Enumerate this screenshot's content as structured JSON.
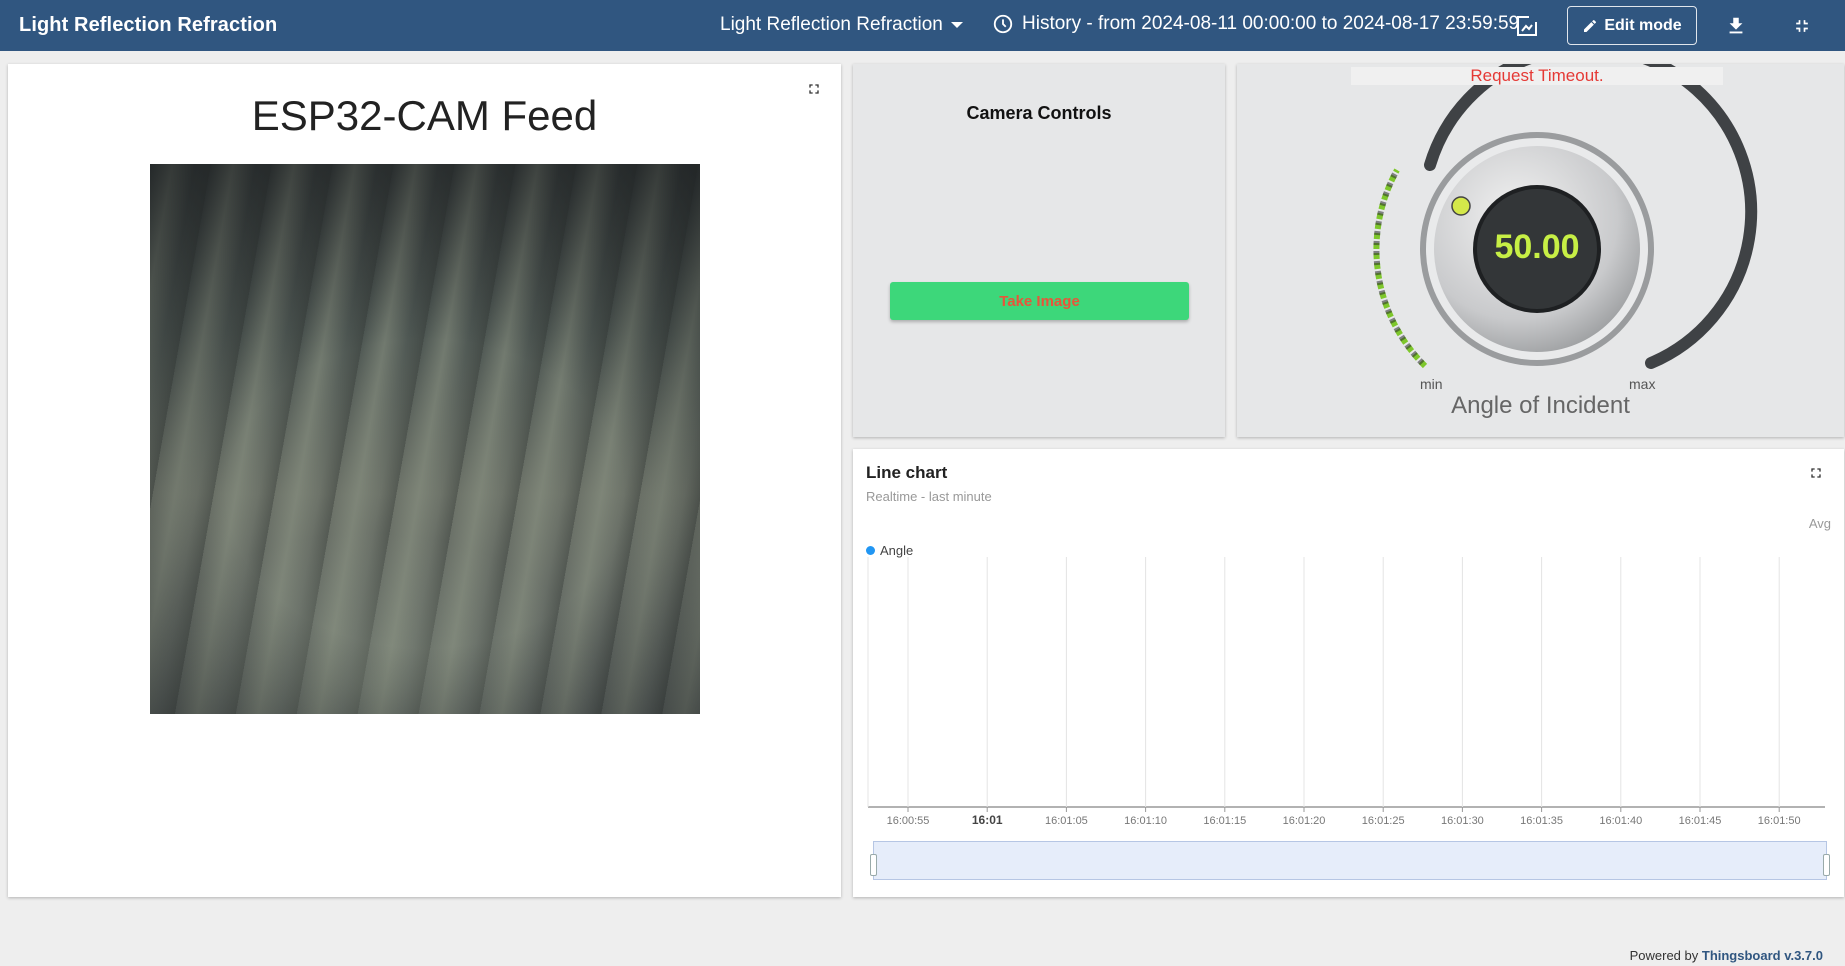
{
  "header": {
    "title": "Light Reflection Refraction",
    "state_selector": "Light Reflection Refraction",
    "history": "History - from 2024-08-11 00:00:00 to 2024-08-17 23:59:59",
    "edit_mode_label": "Edit mode",
    "icons": [
      "clock-icon",
      "fit-screen-icon",
      "pencil-icon",
      "download-icon",
      "exit-fullscreen-icon"
    ]
  },
  "camera_feed": {
    "title": "ESP32-CAM Feed"
  },
  "camera_controls": {
    "title": "Camera Controls",
    "button_label": "Take Image",
    "button_color": "#3dd77a",
    "button_text_color": "#e8553a"
  },
  "knob": {
    "error": "Request Timeout.",
    "value": "50.00",
    "min_label": "min",
    "max_label": "max",
    "label": "Angle of Incident",
    "level_fraction": 0.28,
    "accent": "#a3e635"
  },
  "line_chart": {
    "title": "Line chart",
    "subtitle": "Realtime - last minute",
    "avg_label": "Avg",
    "legend": "Angle",
    "series_color": "#2196f3"
  },
  "chart_data": {
    "type": "line",
    "title": "Line chart",
    "x_ticks": [
      "16:00:55",
      "16:01",
      "16:01:05",
      "16:01:10",
      "16:01:15",
      "16:01:20",
      "16:01:25",
      "16:01:30",
      "16:01:35",
      "16:01:40",
      "16:01:45",
      "16:01:50"
    ],
    "series": [
      {
        "name": "Angle",
        "values": []
      }
    ],
    "grid": true,
    "legend_position": "top-left"
  },
  "footer": {
    "prefix": "Powered by",
    "link": "Thingsboard v.3.7.0"
  }
}
